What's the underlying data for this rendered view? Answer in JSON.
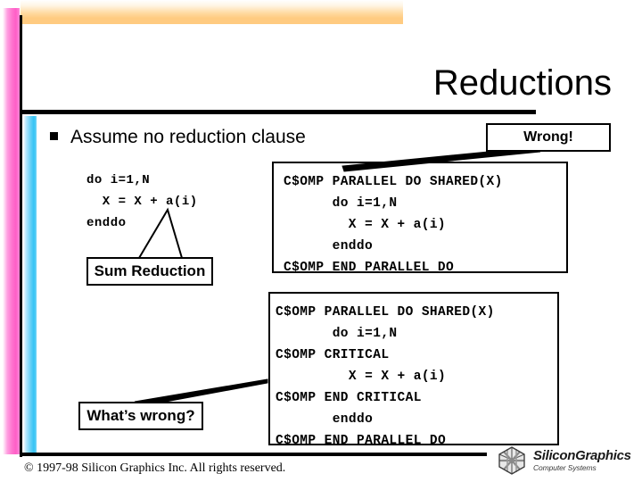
{
  "slide": {
    "title": "Reductions",
    "bullet": {
      "marker": "square-bullet",
      "text": "Assume no reduction clause"
    }
  },
  "code_left": {
    "lines": "do i=1,N\n  X = X + a(i)\nenddo"
  },
  "code_boxes": [
    {
      "id": "top",
      "lines": "C$OMP PARALLEL DO SHARED(X)\n      do i=1,N\n        X = X + a(i)\n      enddo\nC$OMP END PARALLEL DO"
    },
    {
      "id": "bottom",
      "lines": "C$OMP PARALLEL DO SHARED(X)\n       do i=1,N\nC$OMP CRITICAL\n         X = X + a(i)\nC$OMP END CRITICAL\n       enddo\nC$OMP END PARALLEL DO"
    }
  ],
  "callouts": {
    "wrong": "Wrong!",
    "sum_reduction": "Sum Reduction",
    "whats_wrong": "What’s wrong?"
  },
  "footer": {
    "copyright": "© 1997-98 Silicon Graphics Inc. All rights reserved.",
    "logo_name": "SiliconGraphics",
    "logo_sub": "Computer Systems"
  },
  "colors": {
    "accent_orange": "#ffcb81",
    "accent_pink": "#ff5ec7",
    "accent_cyan": "#33c3f5",
    "rule": "#000000",
    "text": "#000000"
  }
}
